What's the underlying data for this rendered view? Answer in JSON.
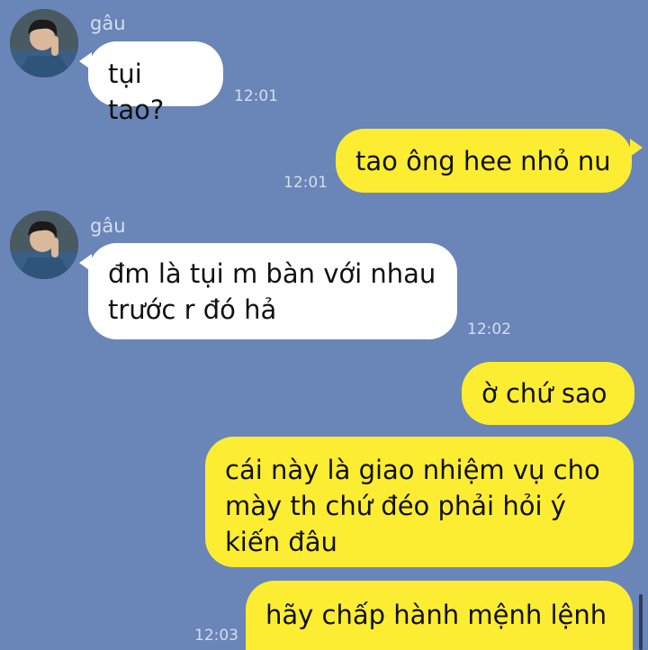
{
  "colors": {
    "background": "#6a85b8",
    "incoming_bubble": "#ffffff",
    "outgoing_bubble": "#fced32",
    "meta_text": "#d6deee"
  },
  "messages": [
    {
      "direction": "in",
      "sender": "gâu",
      "text": "tụi tao?",
      "time": "12:01",
      "avatar_icon": "user-avatar-icon"
    },
    {
      "direction": "out",
      "text": "tao ông hee nhỏ nu",
      "time": "12:01"
    },
    {
      "direction": "in",
      "sender": "gâu",
      "text": "đm là tụi m bàn với nhau\ntrước r đó hả",
      "time": "12:02",
      "avatar_icon": "user-avatar-icon"
    },
    {
      "direction": "out",
      "text": "ờ chứ sao",
      "time": ""
    },
    {
      "direction": "out",
      "text": "cái này là giao nhiệm vụ cho\nmày th chứ đéo phải hỏi ý\nkiến đâu",
      "time": ""
    },
    {
      "direction": "out",
      "text": "hãy chấp hành mệnh lệnh",
      "time": "12:03"
    }
  ]
}
